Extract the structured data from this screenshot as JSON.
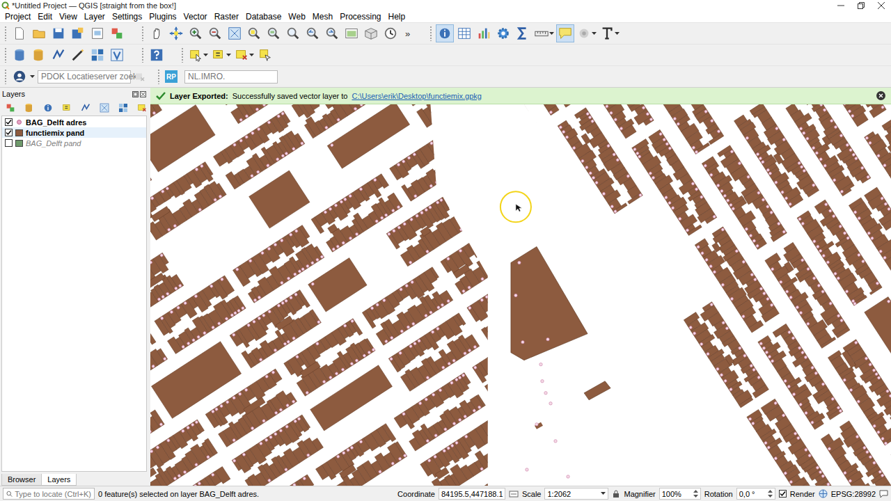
{
  "window": {
    "title": "*Untitled Project — QGIS [straight from the box!]"
  },
  "menu": [
    "Project",
    "Edit",
    "View",
    "Layer",
    "Settings",
    "Plugins",
    "Vector",
    "Raster",
    "Database",
    "Web",
    "Mesh",
    "Processing",
    "Help"
  ],
  "toolbar_rows": [
    [
      {
        "tools": [
          {
            "kind": "new",
            "active": false,
            "dropdown": false
          },
          {
            "kind": "open",
            "active": false,
            "dropdown": false
          },
          {
            "kind": "save",
            "active": false,
            "dropdown": false
          },
          {
            "kind": "save-as",
            "active": false,
            "dropdown": false
          },
          {
            "kind": "layout",
            "active": false,
            "dropdown": false
          },
          {
            "kind": "style",
            "active": false,
            "dropdown": false
          }
        ],
        "overflow": ""
      },
      {
        "tools": [
          {
            "kind": "pan",
            "active": false,
            "dropdown": false
          },
          {
            "kind": "pan-selection",
            "active": false,
            "dropdown": false
          },
          {
            "kind": "zoom-in",
            "active": false,
            "dropdown": false
          },
          {
            "kind": "zoom-out",
            "active": false,
            "dropdown": false
          },
          {
            "kind": "zoom-full",
            "active": false,
            "dropdown": false
          },
          {
            "kind": "zoom-selection",
            "active": false,
            "dropdown": false
          },
          {
            "kind": "zoom-layer",
            "active": false,
            "dropdown": false
          },
          {
            "kind": "zoom-native",
            "active": false,
            "dropdown": false
          },
          {
            "kind": "zoom-last",
            "active": false,
            "dropdown": false
          },
          {
            "kind": "zoom-next",
            "active": false,
            "dropdown": false
          },
          {
            "kind": "map-view",
            "active": false,
            "dropdown": false
          },
          {
            "kind": "map-3d",
            "active": false,
            "dropdown": false
          },
          {
            "kind": "temporal",
            "active": false,
            "dropdown": false
          }
        ],
        "overflow": "»"
      },
      {
        "tools": [
          {
            "kind": "identify",
            "active": true,
            "dropdown": false
          },
          {
            "kind": "table",
            "active": false,
            "dropdown": false
          },
          {
            "kind": "stats",
            "active": false,
            "dropdown": false
          },
          {
            "kind": "gear",
            "active": false,
            "dropdown": false
          },
          {
            "kind": "sum",
            "active": false,
            "dropdown": false
          },
          {
            "kind": "measure",
            "active": false,
            "dropdown": true
          },
          {
            "kind": "tips",
            "active": true,
            "dropdown": false
          },
          {
            "kind": "annotation",
            "active": false,
            "dropdown": true
          },
          {
            "kind": "text",
            "active": false,
            "dropdown": true
          }
        ],
        "overflow": ""
      }
    ],
    [
      {
        "tools": [
          {
            "kind": "db",
            "active": false,
            "dropdown": false
          },
          {
            "kind": "db-add",
            "active": false,
            "dropdown": false
          },
          {
            "kind": "vector",
            "active": false,
            "dropdown": false
          },
          {
            "kind": "digitize",
            "active": false,
            "dropdown": false
          },
          {
            "kind": "raster",
            "active": false,
            "dropdown": false
          },
          {
            "kind": "virtual",
            "active": false,
            "dropdown": false
          }
        ],
        "overflow": ""
      },
      {
        "tools": [
          {
            "kind": "help",
            "active": false,
            "dropdown": false
          }
        ],
        "overflow": ""
      },
      {
        "tools": [
          {
            "kind": "select",
            "active": false,
            "dropdown": true
          },
          {
            "kind": "select-expr",
            "active": false,
            "dropdown": true
          },
          {
            "kind": "deselect",
            "active": false,
            "dropdown": true
          },
          {
            "kind": "select-pointer",
            "active": false,
            "dropdown": false
          }
        ],
        "overflow": ""
      }
    ]
  ],
  "locator_bar": {
    "placeholder": "PDOK Locatieserver zoek",
    "button": "RP",
    "field_placeholder": "NL.IMRO."
  },
  "layers_panel": {
    "title": "Layers",
    "layers": [
      {
        "name": "BAG_Delft adres",
        "checked": true,
        "selected": false,
        "kind": "point",
        "color": "#e8a6c6"
      },
      {
        "name": "functiemix pand",
        "checked": true,
        "selected": true,
        "kind": "polygon",
        "color": "#8d5b3f"
      },
      {
        "name": "BAG_Delft pand",
        "checked": false,
        "selected": false,
        "kind": "polygon",
        "color": "#6f9a6b"
      }
    ],
    "tabs": [
      {
        "label": "Browser",
        "selected": false
      },
      {
        "label": "Layers",
        "selected": true
      }
    ]
  },
  "message_bar": {
    "title": "Layer Exported:",
    "text": "Successfully saved vector layer to",
    "link": "C:\\Users\\erik\\Desktop\\functiemix.gpkg"
  },
  "status_bar": {
    "locate_placeholder": "Type to locate (Ctrl+K)",
    "message": "0 feature(s) selected on layer BAG_Delft adres.",
    "coordinate_label": "Coordinate",
    "coordinate": "84195.5,447188.1",
    "scale_label": "Scale",
    "scale": "1:2062",
    "magnifier_label": "Magnifier",
    "magnifier": "100%",
    "rotation_label": "Rotation",
    "rotation": "0,0 °",
    "render_label": "Render",
    "render": true,
    "crs": "EPSG:28992"
  }
}
